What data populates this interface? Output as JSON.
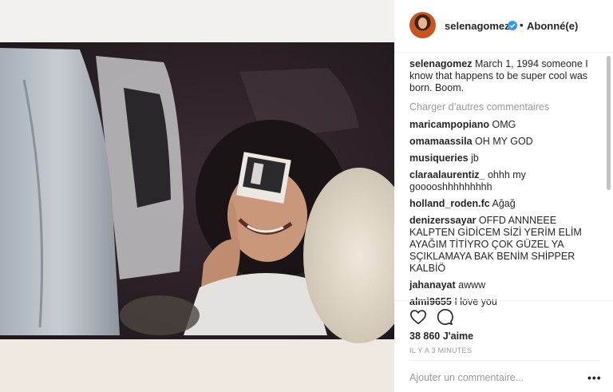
{
  "header": {
    "username": "selenagomez",
    "separator": "•",
    "follow_status": "Abonné(e)"
  },
  "caption": {
    "username": "selenagomez",
    "text": "March 1, 1994 someone I know that happens to be super cool was born. Boom."
  },
  "load_more": "Charger d’autres commentaires",
  "comments": [
    {
      "user": "maricampopiano",
      "text": "OMG"
    },
    {
      "user": "omamaassila",
      "text": "OH MY GOD"
    },
    {
      "user": "musiqueries",
      "text": "jb"
    },
    {
      "user": "claraalaurentiz_",
      "text": "ohhh my gooooshhhhhhhhh"
    },
    {
      "user": "holland_roden.fc",
      "text": "Ağağ"
    },
    {
      "user": "denizerssayar",
      "text": "OFFD ANNNEEE KALPTEN GİDİCEM SİZİ YERİM ELİM AYAĞIM TİTİYRO ÇOK GÜZEL YA SÇIKLAMAYA BAK BENİM SHİPPER KALBİÖ"
    },
    {
      "user": "jahanayat",
      "text": "awww"
    },
    {
      "user": "almi9655",
      "text": "I love you"
    }
  ],
  "actions": {
    "like_icon": "heart-outline-icon",
    "comment_icon": "speech-bubble-icon",
    "likes": "38 860 J'aime",
    "timestamp": "IL Y A 3 MINUTES",
    "add_comment_placeholder": "Ajouter un commentaire...",
    "more_label": "•••"
  },
  "colors": {
    "text": "#262626",
    "muted": "#999999",
    "verified": "#3897f0",
    "border": "#efefef"
  }
}
